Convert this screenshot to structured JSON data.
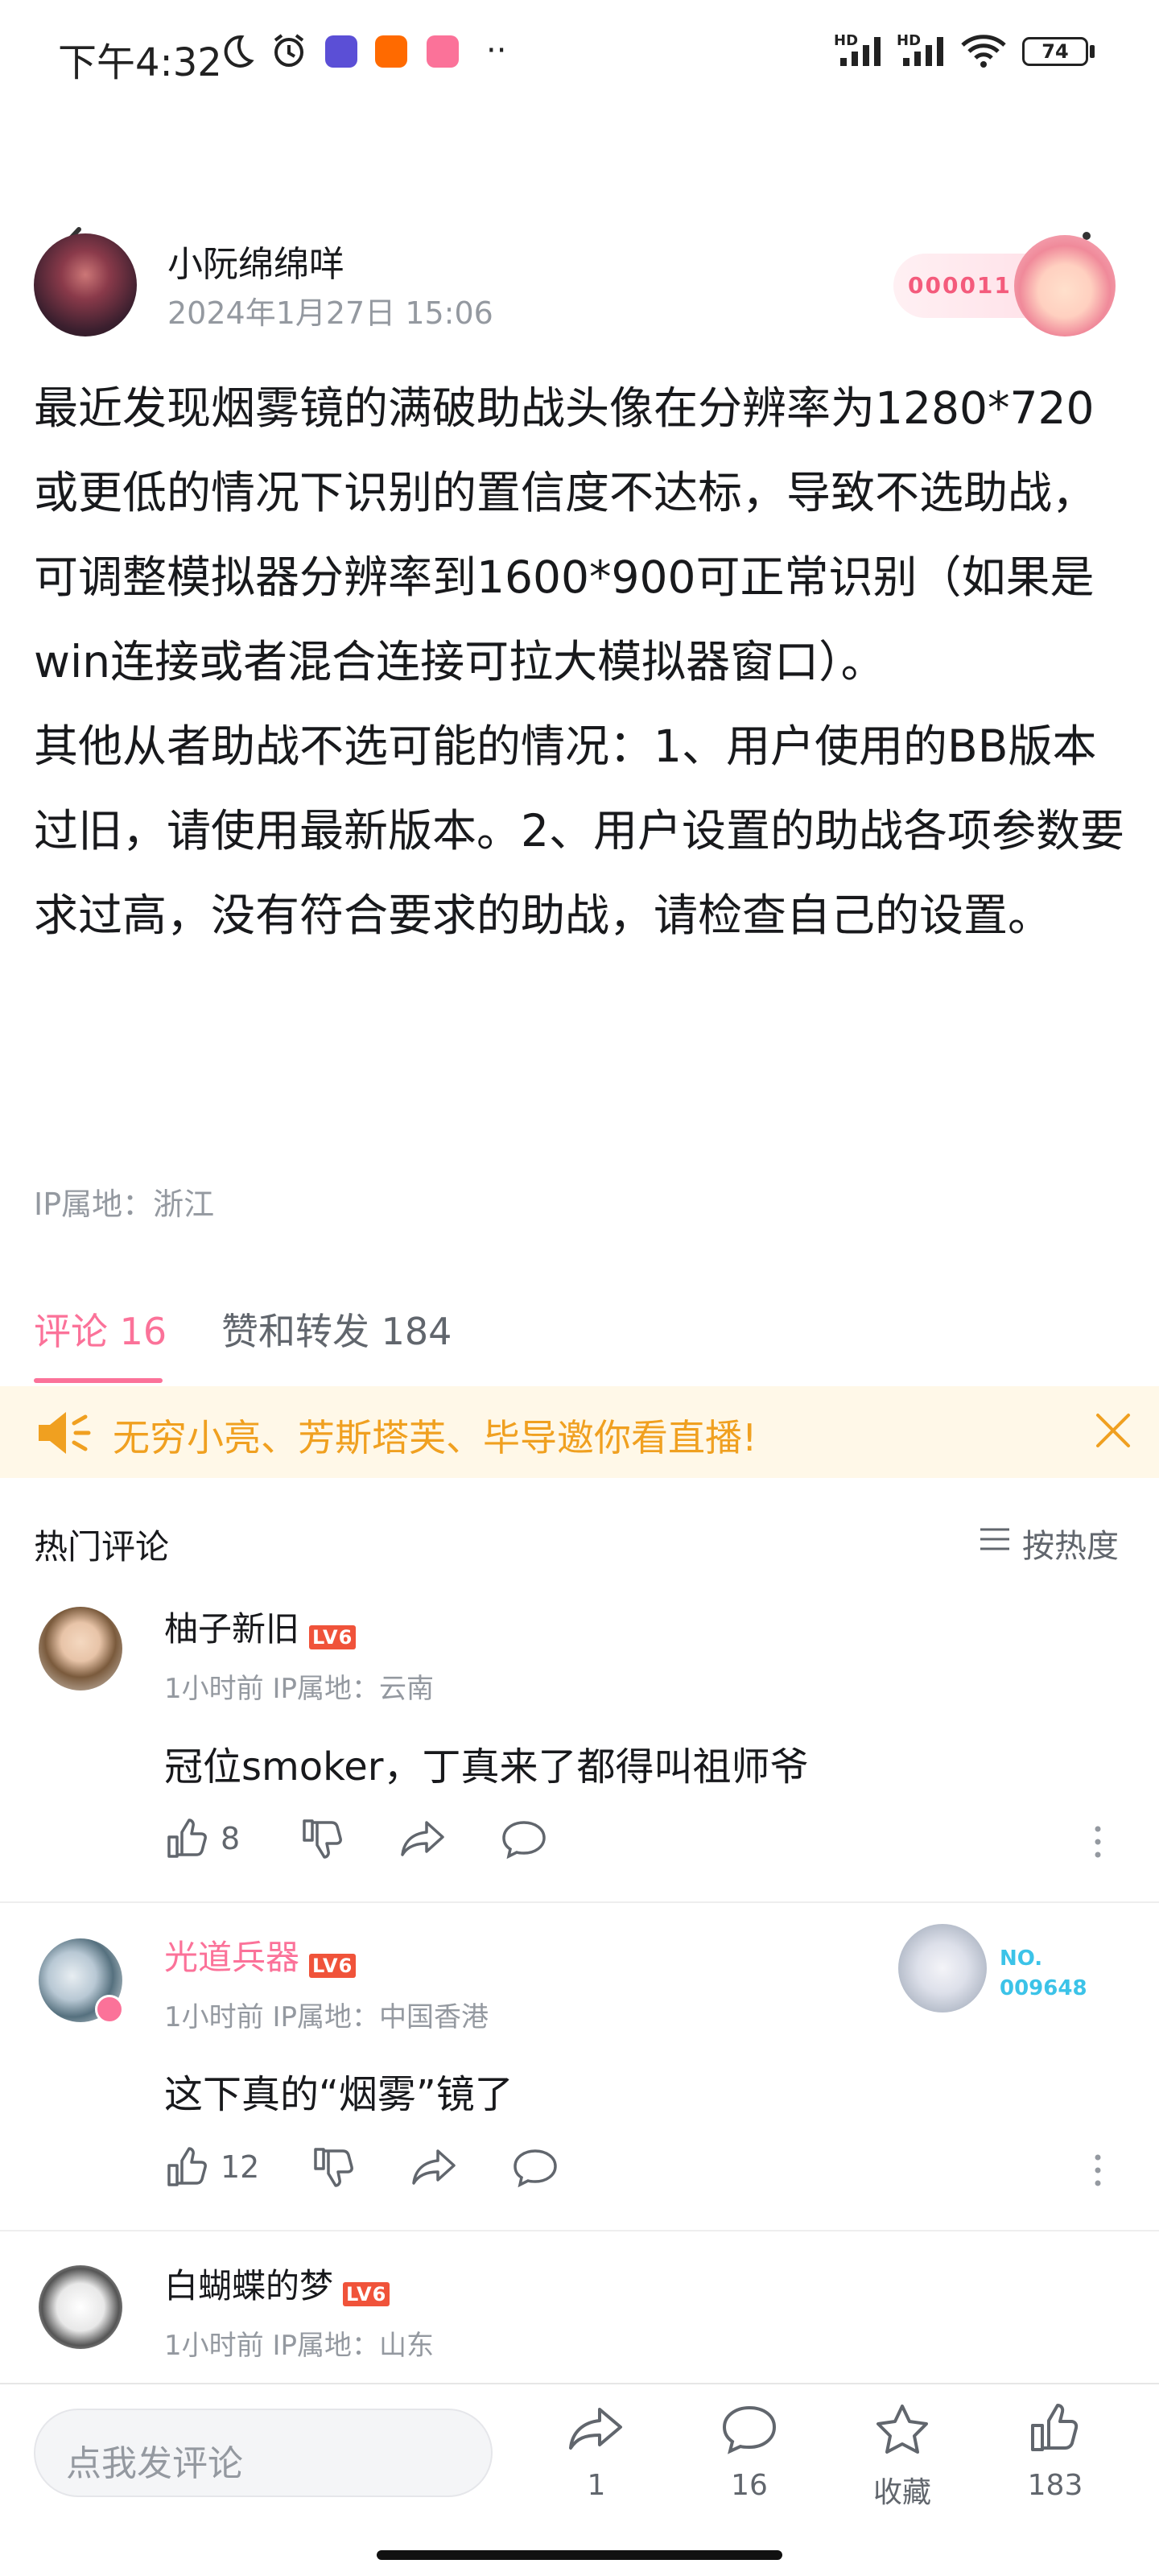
{
  "status_bar": {
    "time": "下午4:32",
    "battery": "74",
    "network": "HD",
    "more": "··"
  },
  "post": {
    "author": "小阮绵绵咩",
    "time": "2024年1月27日 15:06",
    "badge_number": "000011",
    "paragraphs": [
      "最近发现烟雾镜的满破助战头像在分辨率为1280*720或更低的情况下识别的置信度不达标，导致不选助战，可调整模拟器分辨率到1600*900可正常识别（如果是win连接或者混合连接可拉大模拟器窗口）。",
      "其他从者助战不选可能的情况：1、用户使用的BB版本过旧，请使用最新版本。2、用户设置的助战各项参数要求过高，没有符合要求的助战，请检查自己的设置。"
    ],
    "ip": "IP属地：浙江"
  },
  "tabs": {
    "comments": "评论 16",
    "likes_reposts": "赞和转发 184"
  },
  "notice": {
    "text": "无穷小亮、芳斯塔芙、毕导邀你看直播!"
  },
  "comments_section": {
    "title": "热门评论",
    "sort_label": "按热度",
    "items": [
      {
        "name": "柚子新旧",
        "level": "LV6",
        "meta": "1小时前  IP属地：云南",
        "text": "冠位smoker，丁真来了都得叫祖师爷",
        "likes": "8"
      },
      {
        "name": "光道兵器",
        "level": "LV6",
        "meta": "1小时前  IP属地：中国香港",
        "text": "这下真的“烟雾”镜了",
        "likes": "12",
        "badge_label": "NO.",
        "badge_number": "009648"
      },
      {
        "name": "白蝴蝶的梦",
        "level": "LV6",
        "meta": "1小时前  IP属地：山东"
      }
    ]
  },
  "bottom_bar": {
    "input_placeholder": "点我发评论",
    "share_count": "1",
    "comment_count": "16",
    "favorite_label": "收藏",
    "like_count": "183"
  },
  "colors": {
    "accent_pink": "#fb7299",
    "notice_orange": "#f0a020",
    "level_red": "#f0533a",
    "muted_gray": "#9499a0"
  }
}
